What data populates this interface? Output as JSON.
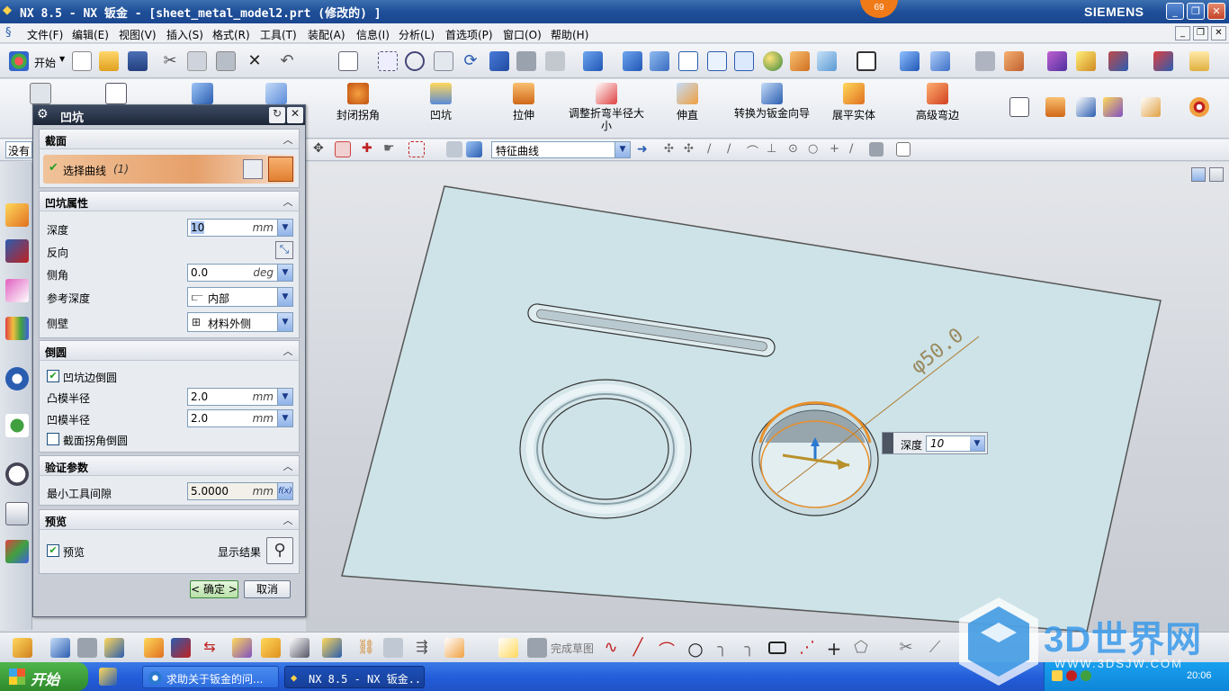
{
  "window": {
    "title": "NX 8.5 - NX 钣金 - [sheet_metal_model2.prt  (修改的) ]",
    "brand": "SIEMENS",
    "badge": "69"
  },
  "menubar": [
    "文件(F)",
    "编辑(E)",
    "视图(V)",
    "插入(S)",
    "格式(R)",
    "工具(T)",
    "装配(A)",
    "信息(I)",
    "分析(L)",
    "首选项(P)",
    "窗口(O)",
    "帮助(H)"
  ],
  "toolbar1": {
    "start_label": "开始"
  },
  "toolbar2": {
    "buttons": [
      "封闭拐角",
      "凹坑",
      "拉伸",
      "调整折弯半径大小",
      "伸直",
      "转换为钣金向导",
      "展平实体",
      "高级弯边"
    ],
    "left_label": "在任\n绘"
  },
  "toolbar3": {
    "filter_left": "没有",
    "select_label": "选择",
    "feature_combo": "特征曲线"
  },
  "dialog": {
    "title": "凹坑",
    "section_label": "截面",
    "select_curve": "选择曲线",
    "select_count": "(1)",
    "props_label": "凹坑属性",
    "depth_label": "深度",
    "depth_value": "10",
    "depth_unit": "mm",
    "reverse_label": "反向",
    "side_angle_label": "侧角",
    "side_angle_value": "0.0",
    "side_angle_unit": "deg",
    "ref_depth_label": "参考深度",
    "ref_depth_value": "内部",
    "sidewall_label": "侧壁",
    "sidewall_value": "材料外侧",
    "fillet_label": "倒圆",
    "edge_fillet_label": "凹坑边倒圆",
    "edge_fillet_checked": true,
    "punch_radius_label": "凸模半径",
    "punch_radius_value": "2.0",
    "die_radius_label": "凹模半径",
    "die_radius_value": "2.0",
    "corner_fillet_label": "截面拐角倒圆",
    "corner_fillet_checked": false,
    "verify_label": "验证参数",
    "min_clearance_label": "最小工具间隙",
    "min_clearance_value": "5.0000",
    "min_clearance_unit": "mm",
    "preview_section": "预览",
    "preview_label": "预览",
    "preview_checked": true,
    "show_result_label": "显示结果",
    "ok_label": "< 确定 >",
    "cancel_label": "取消"
  },
  "viewport": {
    "dimension_label": "φ50.0",
    "depth_tag_label": "深度",
    "depth_tag_value": "10"
  },
  "bottom_toolbar": {
    "finish_sketch": "完成草图"
  },
  "taskbar": {
    "start": "开始",
    "tasks": [
      "求助关于钣金的问...",
      "NX 8.5 - NX 钣金..."
    ],
    "clock": "20:06"
  },
  "watermark": {
    "text": "3D世界网",
    "url": "WWW.3DSJW.COM"
  },
  "colors": {
    "plate": "#cde3e8",
    "accent_orange": "#e8902a",
    "title_blue": "#1f4f98"
  }
}
